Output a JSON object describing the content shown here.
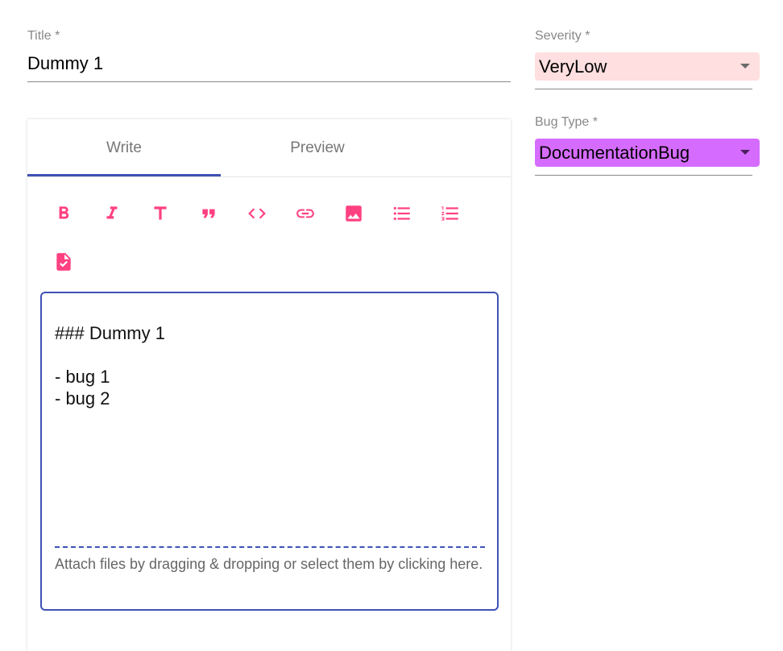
{
  "title_field": {
    "label": "Title *",
    "value": "Dummy 1"
  },
  "severity_field": {
    "label": "Severity *",
    "value": "VeryLow",
    "bg_color": "#ffdfdf"
  },
  "bugtype_field": {
    "label": "Bug Type *",
    "value": "DocumentationBug",
    "bg_color": "#d66cff"
  },
  "editor": {
    "tabs": [
      {
        "label": "Write",
        "active": true
      },
      {
        "label": "Preview",
        "active": false
      }
    ],
    "toolbar": [
      "bold-icon",
      "italic-icon",
      "header-icon",
      "quote-icon",
      "code-icon",
      "link-icon",
      "image-icon",
      "unordered-list-icon",
      "ordered-list-icon",
      "checklist-icon"
    ],
    "content": "### Dummy 1\n\n- bug 1\n- bug 2",
    "attach_hint": "Attach files by dragging & dropping or select them by clicking here."
  },
  "colors": {
    "accent": "#ff4081",
    "primary": "#3f51b5"
  }
}
